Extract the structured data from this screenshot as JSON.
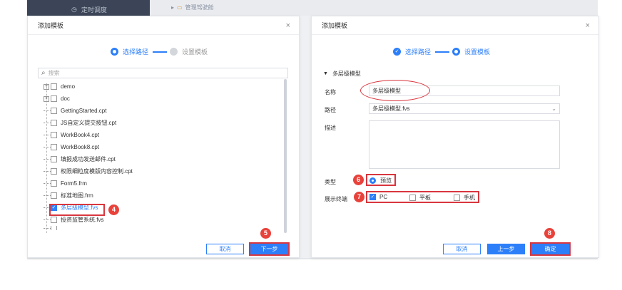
{
  "background": {
    "top_item": "定时调度",
    "top_item2": "管理驾驶舱"
  },
  "left_dialog": {
    "title": "添加模板",
    "close": "×",
    "steps": [
      "选择路径",
      "设置模板"
    ],
    "search_placeholder": "搜索",
    "tree": [
      {
        "label": "demo",
        "type": "folder"
      },
      {
        "label": "doc",
        "type": "folder"
      },
      {
        "label": "GettingStarted.cpt",
        "type": "file"
      },
      {
        "label": "JS自定义提交按钮.cpt",
        "type": "file"
      },
      {
        "label": "WorkBook4.cpt",
        "type": "file"
      },
      {
        "label": "WorkBook8.cpt",
        "type": "file"
      },
      {
        "label": "填报成功发送邮件.cpt",
        "type": "file"
      },
      {
        "label": "权限细粒度模版内容控制.cpt",
        "type": "file"
      },
      {
        "label": "Form5.frm",
        "type": "file"
      },
      {
        "label": "标准地图.frm",
        "type": "file"
      },
      {
        "label": "多层级模型.fvs",
        "type": "file",
        "checked": true
      },
      {
        "label": "投资监管系统.fvs",
        "type": "file"
      }
    ],
    "cancel": "取消",
    "next": "下一步",
    "badge_select": "4",
    "badge_next": "5"
  },
  "right_dialog": {
    "title": "添加模板",
    "close": "×",
    "steps": [
      "选择路径",
      "设置模板"
    ],
    "section": "多层级模型",
    "name_label": "名称",
    "name_value": "多层级模型",
    "path_label": "路径",
    "path_value": "多层级模型.fvs",
    "desc_label": "描述",
    "type_label": "类型",
    "type_option": "预览",
    "terminal_label": "展示终端",
    "terminals": [
      "PC",
      "平板",
      "手机"
    ],
    "cancel": "取消",
    "prev": "上一步",
    "confirm": "确定",
    "badge_type": "6",
    "badge_terminal": "7",
    "badge_confirm": "8"
  },
  "colors": {
    "accent": "#2d7ff9",
    "annotation": "#e8423b"
  }
}
